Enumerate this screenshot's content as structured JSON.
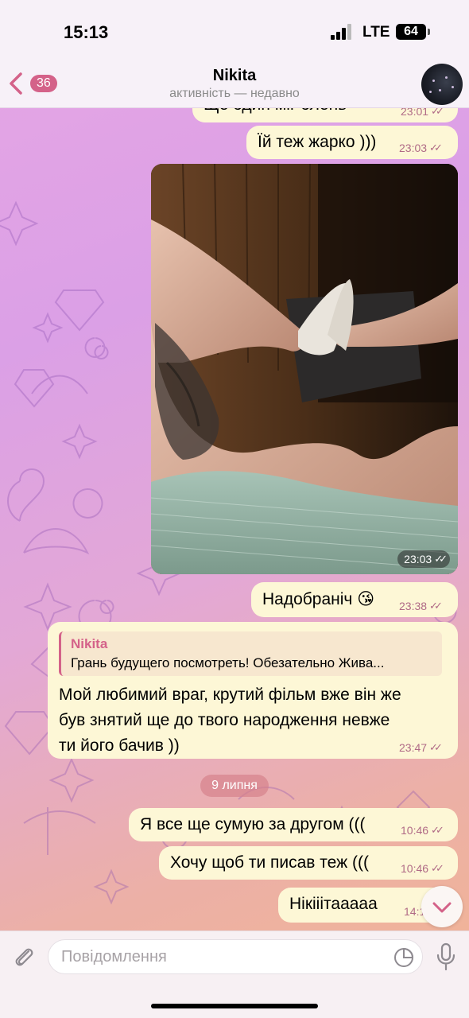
{
  "status_bar": {
    "time": "15:13",
    "carrier": "LTE",
    "battery": "64"
  },
  "header": {
    "back_count": "36",
    "name": "Nikita",
    "status": "активність — недавно"
  },
  "messages": {
    "partial": {
      "text": "Ще один міг олень",
      "time": "23:01"
    },
    "m1": {
      "text": "Їй теж жарко )))",
      "time": "23:03"
    },
    "photo": {
      "time": "23:03"
    },
    "m2": {
      "text": "Надобраніч 😘",
      "time": "23:38"
    },
    "reply": {
      "quote_name": "Nikita",
      "quote_text": "Грань будущего посмотреть! Обезательно Жива...",
      "lines": [
        "Мой любимий враг, крутий фільм вже він же",
        "був знятий ще до твого народження невже",
        "ти його бачив ))"
      ],
      "time": "23:47"
    },
    "date_separator": "9 липня",
    "m3": {
      "text": "Я все ще сумую за другом (((",
      "time": "10:46"
    },
    "m4": {
      "text": "Хочу щоб ти писав теж (((",
      "time": "10:46"
    },
    "m5": {
      "text": "Нікііітааааа",
      "time": "14:1"
    }
  },
  "input": {
    "placeholder": "Повідомлення"
  },
  "icons": [
    "back-chevron-icon",
    "signal-icon",
    "battery-icon",
    "attach-icon",
    "sticker-icon",
    "mic-icon",
    "chevron-down-icon",
    "double-check-icon"
  ],
  "colors": {
    "accent": "#d46289",
    "bubble": "#fdf7d6",
    "header_bg": "#f7f1f8",
    "meta": "#b06a86"
  }
}
